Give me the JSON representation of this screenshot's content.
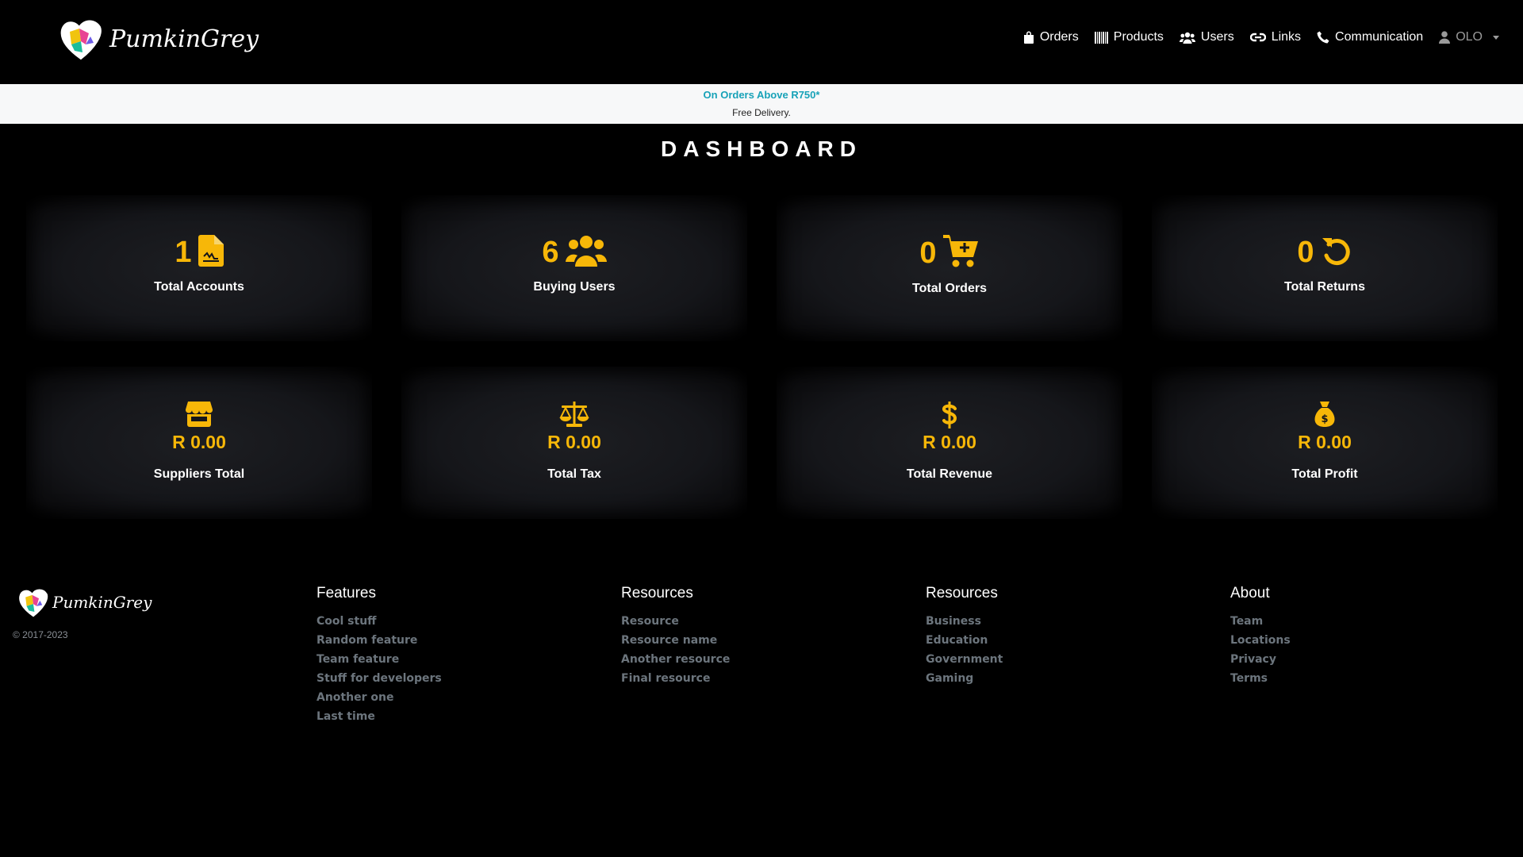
{
  "brand": {
    "name": "PumkinGrey"
  },
  "nav": {
    "items": [
      {
        "label": "Orders",
        "icon": "shopping-bag-icon"
      },
      {
        "label": "Products",
        "icon": "barcode-icon"
      },
      {
        "label": "Users",
        "icon": "users-icon"
      },
      {
        "label": "Links",
        "icon": "link-icon"
      },
      {
        "label": "Communication",
        "icon": "phone-icon"
      }
    ],
    "user": {
      "label": "OLO",
      "icon": "user-icon"
    }
  },
  "promo": {
    "title": "On Orders Above R750*",
    "subtitle": "Free Delivery."
  },
  "dashboard": {
    "title": "DASHBOARD",
    "stats": [
      {
        "value": "1",
        "label": "Total Accounts",
        "icon": "file-invoice-icon"
      },
      {
        "value": "6",
        "label": "Buying Users",
        "icon": "users-icon"
      },
      {
        "value": "0",
        "label": "Total Orders",
        "icon": "cart-icon"
      },
      {
        "value": "0",
        "label": "Total Returns",
        "icon": "undo-icon"
      }
    ],
    "money": [
      {
        "value": "R 0.00",
        "label": "Suppliers Total",
        "icon": "store-icon"
      },
      {
        "value": "R 0.00",
        "label": "Total Tax",
        "icon": "scale-icon"
      },
      {
        "value": "R 0.00",
        "label": "Total Revenue",
        "icon": "dollar-icon"
      },
      {
        "value": "R 0.00",
        "label": "Total Profit",
        "icon": "money-bag-icon"
      }
    ]
  },
  "footer": {
    "copyright": "© 2017-2023",
    "columns": [
      {
        "title": "Features",
        "links": [
          "Cool stuff",
          "Random feature",
          "Team feature",
          "Stuff for developers",
          "Another one",
          "Last time"
        ]
      },
      {
        "title": "Resources",
        "links": [
          "Resource",
          "Resource name",
          "Another resource",
          "Final resource"
        ]
      },
      {
        "title": "Resources",
        "links": [
          "Business",
          "Education",
          "Government",
          "Gaming"
        ]
      },
      {
        "title": "About",
        "links": [
          "Team",
          "Locations",
          "Privacy",
          "Terms"
        ]
      }
    ]
  },
  "colors": {
    "accent": "#f7b708",
    "promo": "#17a2b8",
    "footer_link": "#6c757d"
  }
}
